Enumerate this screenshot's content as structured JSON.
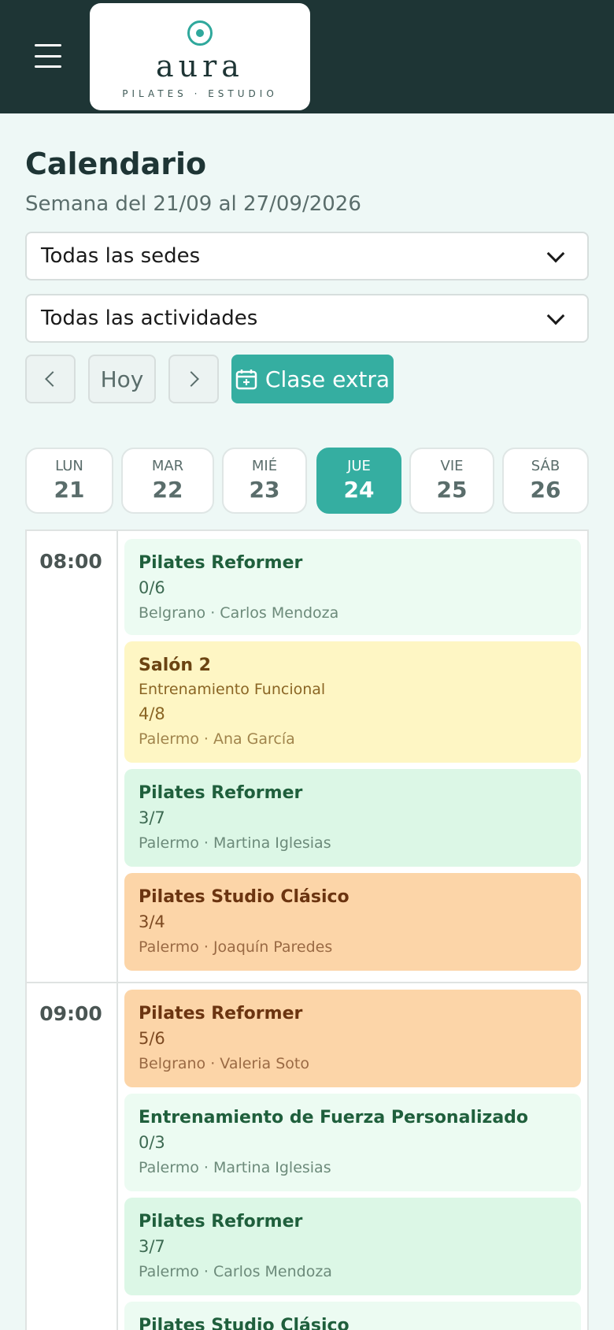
{
  "header": {
    "logo_word": "aura",
    "logo_sub": "PILATES · ESTUDIO"
  },
  "page": {
    "title": "Calendario",
    "subtitle": "Semana del 21/09 al 27/09/2026"
  },
  "filters": {
    "sede": "Todas las sedes",
    "actividad": "Todas las actividades"
  },
  "nav": {
    "today": "Hoy",
    "extra_class": "Clase extra"
  },
  "days": [
    {
      "name": "LUN",
      "date": "21"
    },
    {
      "name": "MAR",
      "date": "22"
    },
    {
      "name": "MIÉ",
      "date": "23"
    },
    {
      "name": "JUE",
      "date": "24"
    },
    {
      "name": "VIE",
      "date": "25"
    },
    {
      "name": "SÁB",
      "date": "26"
    }
  ],
  "schedule": {
    "slots": [
      "08:00",
      "09:00"
    ],
    "classes": [
      {
        "title": "Pilates Reformer",
        "capacity": "0/6",
        "meta": "Belgrano · Carlos Mendoza"
      },
      {
        "title": "Salón 2",
        "subtitle": "Entrenamiento Funcional",
        "capacity": "4/8",
        "meta": "Palermo · Ana García"
      },
      {
        "title": "Pilates Reformer",
        "capacity": "3/7",
        "meta": "Palermo · Martina Iglesias"
      },
      {
        "title": "Pilates Studio Clásico",
        "capacity": "3/4",
        "meta": "Palermo · Joaquín Paredes"
      },
      {
        "title": "Pilates Reformer",
        "capacity": "5/6",
        "meta": "Belgrano · Valeria Soto"
      },
      {
        "title": "Entrenamiento de Fuerza Personalizado",
        "capacity": "0/3",
        "meta": "Palermo · Martina Iglesias"
      },
      {
        "title": "Pilates Reformer",
        "capacity": "3/7",
        "meta": "Palermo · Carlos Mendoza"
      },
      {
        "title": "Pilates Studio Clásico"
      }
    ]
  }
}
